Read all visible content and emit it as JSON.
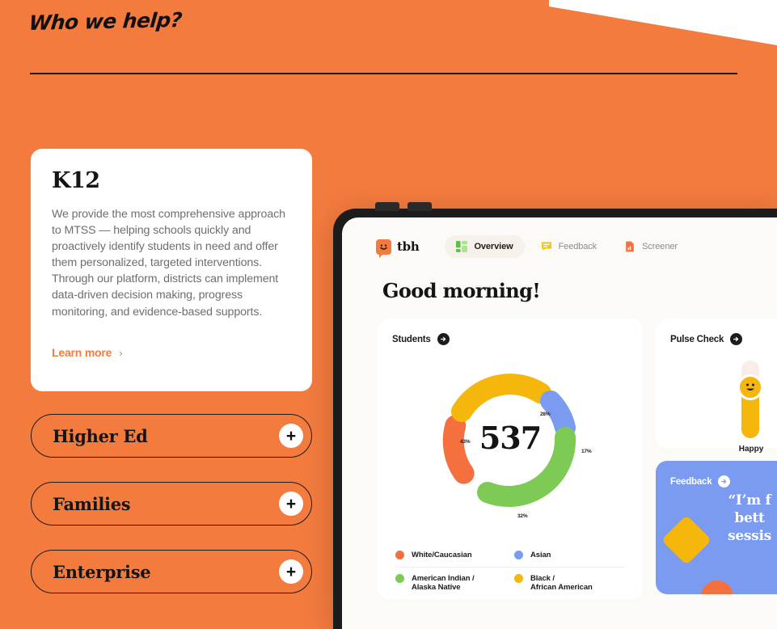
{
  "theme": {
    "brand_orange": "#F47B3E",
    "ink": "#1b1b1b",
    "card_white": "#ffffff",
    "screen_bg": "#FCFAF7",
    "chart_orange": "#F4703E",
    "chart_yellow": "#F5B70C",
    "chart_green": "#7DCB54",
    "chart_blue": "#7B9BF0"
  },
  "section": {
    "title": "Who we help?"
  },
  "k12": {
    "title": "K12",
    "body": "We provide the most comprehensive approach to MTSS — helping schools quickly and proactively identify students in need and offer them personalized, targeted interventions. Through our platform, districts can implement data-driven decision making, progress monitoring, and evidence-based supports.",
    "learn_more": "Learn more",
    "chevron": "›"
  },
  "accordion": {
    "plus": "+",
    "items": [
      {
        "label": "Higher Ed"
      },
      {
        "label": "Families"
      },
      {
        "label": "Enterprise"
      }
    ]
  },
  "app": {
    "brand": "tbh",
    "greeting": "Good morning!",
    "tabs": [
      {
        "label": "Overview",
        "icon": "dashboard-grid-icon",
        "active": true
      },
      {
        "label": "Feedback",
        "icon": "speech-list-icon",
        "active": false
      },
      {
        "label": "Screener",
        "icon": "document-chart-icon",
        "active": false
      }
    ]
  },
  "students": {
    "title": "Students",
    "total": "537"
  },
  "pulse": {
    "title": "Pulse Check",
    "value_label": "Happy"
  },
  "feedback": {
    "title": "Feedback",
    "quote_line1": "“I’m f",
    "quote_line2": "bett",
    "quote_line3": "sessis"
  },
  "chart_data": {
    "type": "pie",
    "title": "Students",
    "subtitle": "537",
    "center_value": "537",
    "categories": [
      "White/Caucasian",
      "American Indian / Alaska Native",
      "Asian",
      "Black / African American"
    ],
    "values": [
      43,
      32,
      17,
      28
    ],
    "labels": [
      "43%",
      "32%",
      "17%",
      "28%"
    ],
    "colors": [
      "#F4703E",
      "#7DCB54",
      "#7B9BF0",
      "#F5B70C"
    ],
    "legend_position": "bottom",
    "grid": false,
    "legend": [
      {
        "label": "White/Caucasian",
        "color": "#F4703E"
      },
      {
        "label": "Asian",
        "color": "#7B9BF0"
      },
      {
        "label": "American Indian /",
        "label2": "Alaska Native",
        "color": "#7DCB54"
      },
      {
        "label": "Black /",
        "label2": "African American",
        "color": "#F5B70C"
      }
    ]
  }
}
